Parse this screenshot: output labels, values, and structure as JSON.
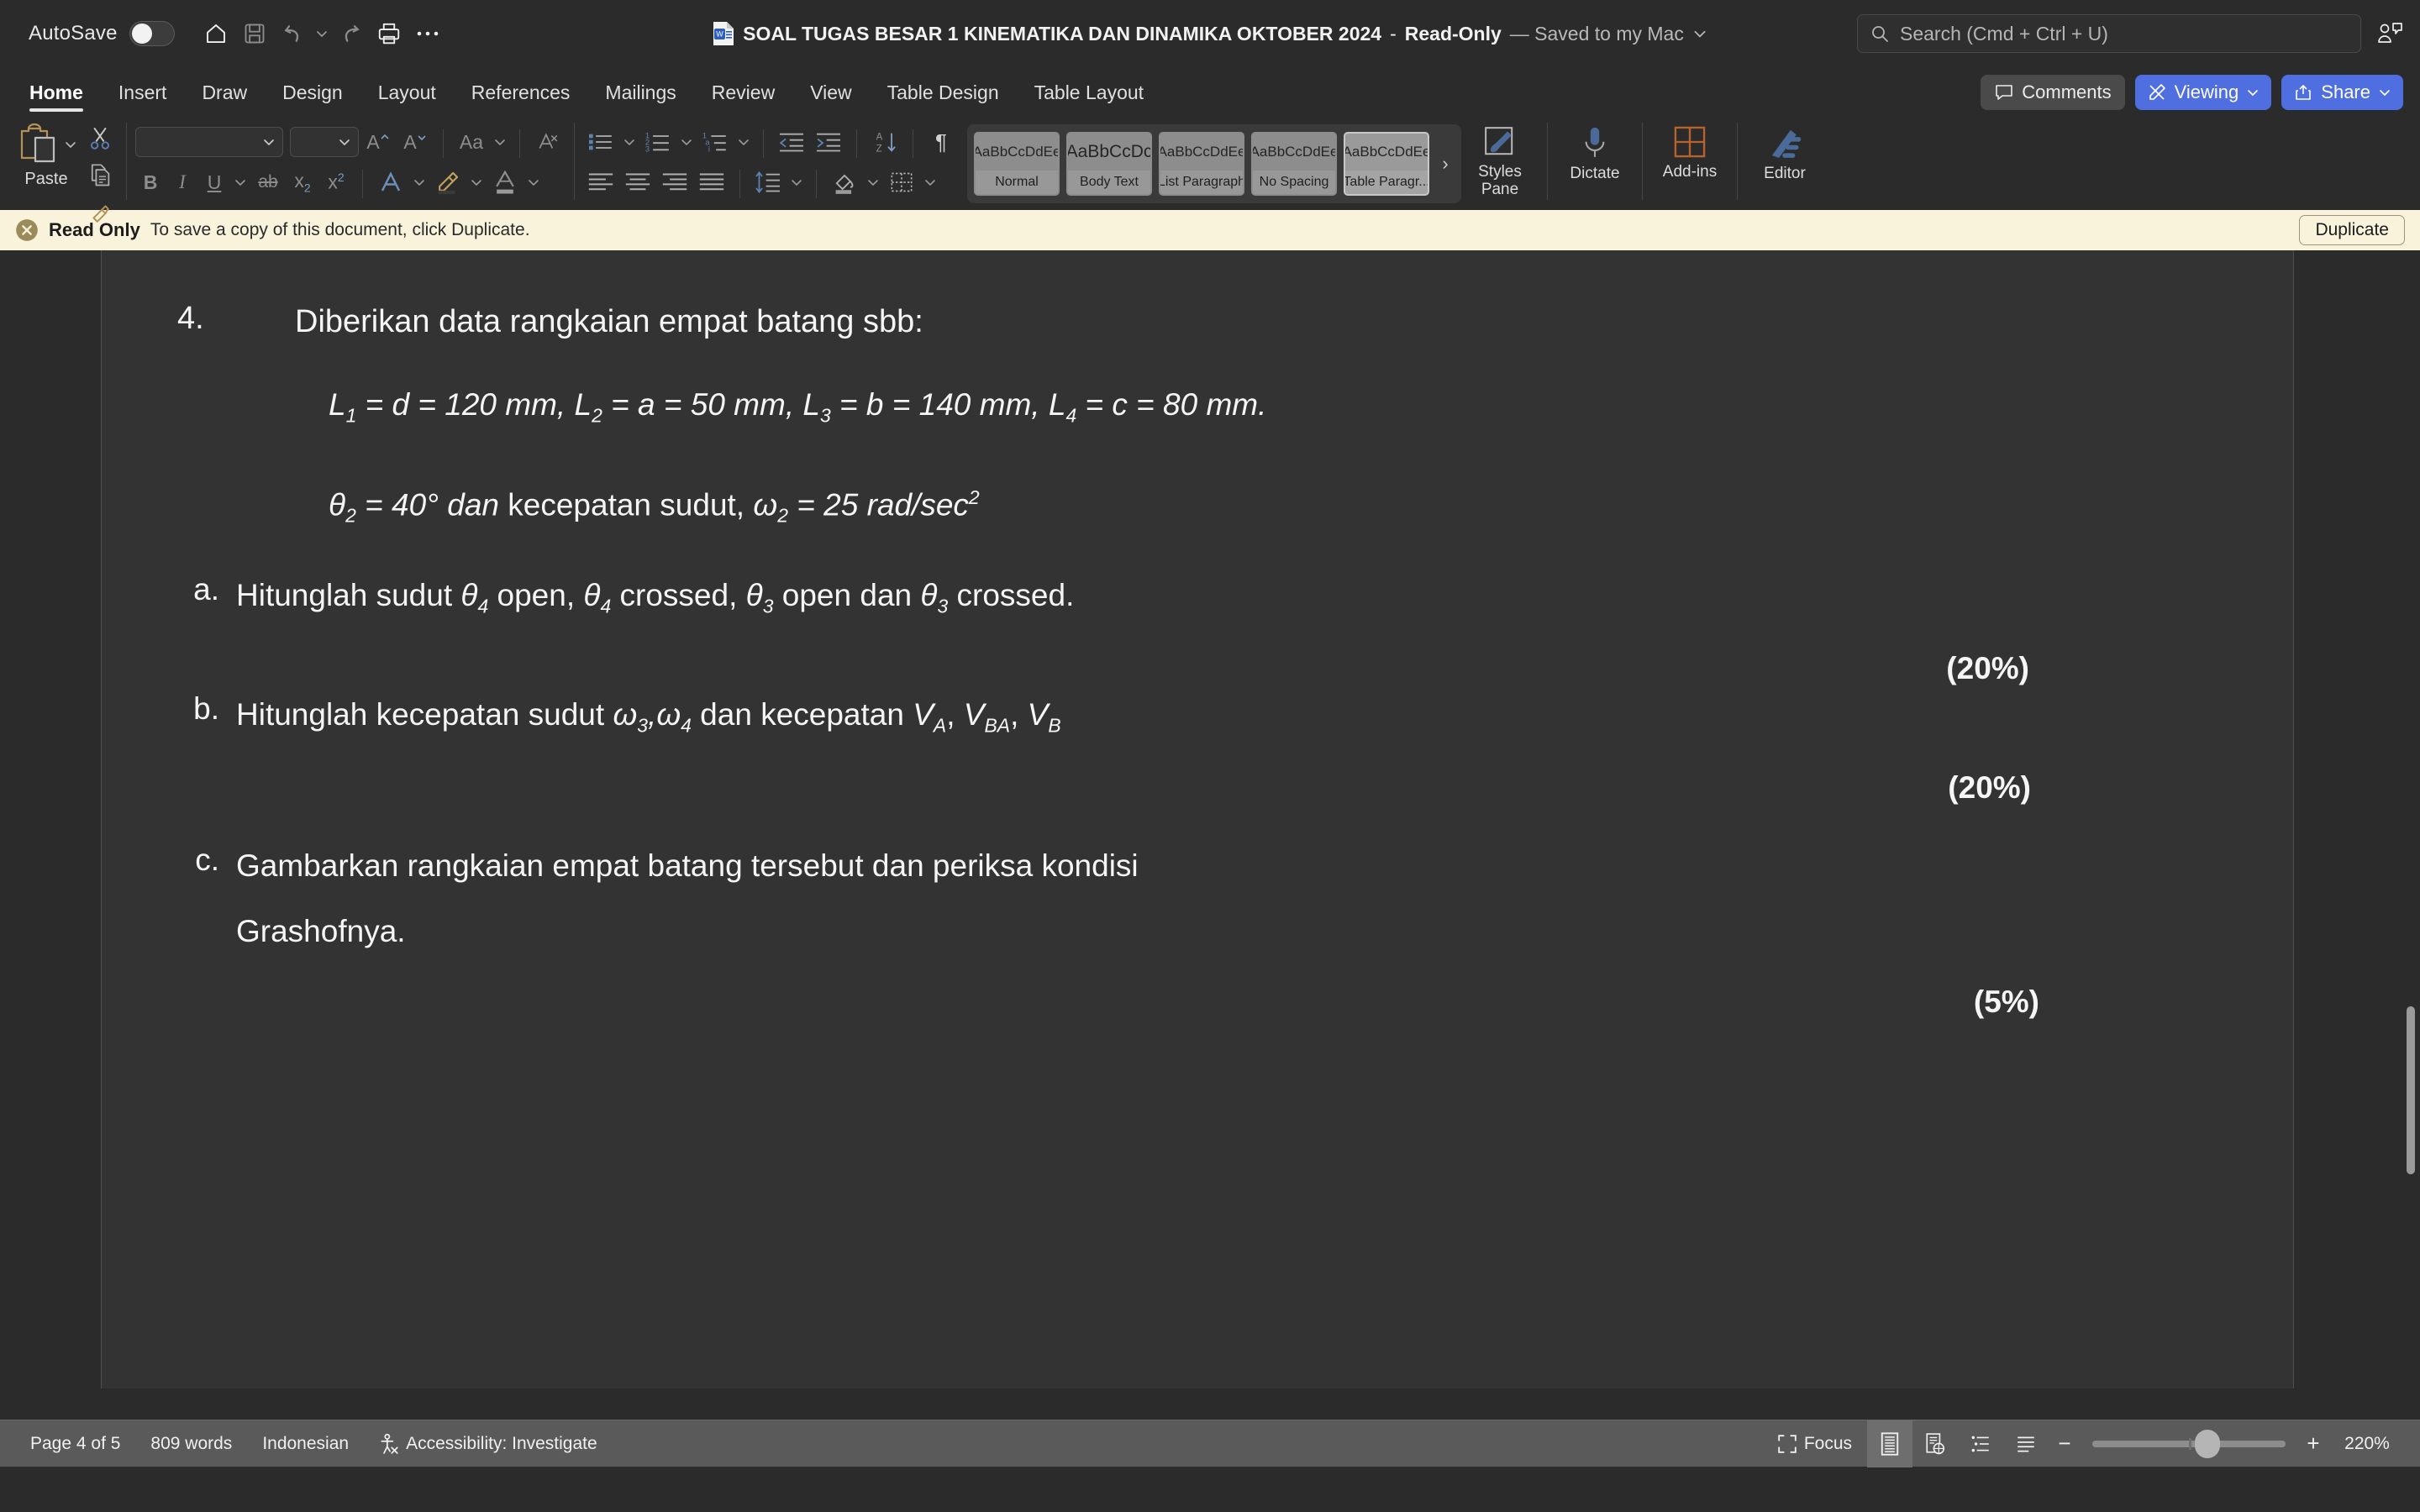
{
  "titlebar": {
    "autosave_label": "AutoSave",
    "autosave_state": "off",
    "quick_access": [
      "home-icon",
      "save-icon",
      "undo-icon",
      "undo-chevron-icon",
      "redo-icon",
      "print-icon",
      "more-icon"
    ],
    "doc_name": "SOAL TUGAS BESAR 1 KINEMATIKA DAN DINAMIKA OKTOBER 2024",
    "separator": "-",
    "read_only": "Read-Only",
    "saved_status": "— Saved to my Mac",
    "search_placeholder": "Search (Cmd + Ctrl + U)",
    "account_icon": "person-comment-icon"
  },
  "ribbon_tabs": {
    "items": [
      {
        "label": "Home",
        "active": true
      },
      {
        "label": "Insert",
        "active": false
      },
      {
        "label": "Draw",
        "active": false
      },
      {
        "label": "Design",
        "active": false
      },
      {
        "label": "Layout",
        "active": false
      },
      {
        "label": "References",
        "active": false
      },
      {
        "label": "Mailings",
        "active": false
      },
      {
        "label": "Review",
        "active": false
      },
      {
        "label": "View",
        "active": false
      },
      {
        "label": "Table Design",
        "active": false
      },
      {
        "label": "Table Layout",
        "active": false
      }
    ],
    "comments_label": "Comments",
    "viewing_label": "Viewing",
    "share_label": "Share"
  },
  "ribbon": {
    "paste_label": "Paste",
    "font_name_value": "",
    "font_size_value": "",
    "grow_font": "A",
    "shrink_font": "A",
    "change_case": "Aa",
    "clear_format": "A",
    "bold": "B",
    "italic": "I",
    "underline": "U",
    "strikethrough": "ab",
    "subscript": "x₂",
    "superscript": "x²",
    "text_effects": "A",
    "highlight": "highlight-icon",
    "font_color": "A",
    "styles": [
      {
        "preview": "AaBbCcDdEe",
        "name": "Normal",
        "selected": false,
        "big": false
      },
      {
        "preview": "AaBbCcDc",
        "name": "Body Text",
        "selected": false,
        "big": true
      },
      {
        "preview": "AaBbCcDdEe",
        "name": "List Paragraph",
        "selected": false,
        "big": false
      },
      {
        "preview": "AaBbCcDdEe",
        "name": "No Spacing",
        "selected": false,
        "big": false
      },
      {
        "preview": "AaBbCcDdEe",
        "name": "Table Paragr...",
        "selected": true,
        "big": false
      }
    ],
    "gallery_more": "›",
    "styles_pane_label": "Styles Pane",
    "dictate_label": "Dictate",
    "addins_label": "Add-ins",
    "editor_label": "Editor"
  },
  "banner": {
    "title": "Read Only",
    "message": "To save a copy of this document, click Duplicate.",
    "duplicate_label": "Duplicate"
  },
  "document": {
    "q_number": "4.",
    "q_text": "Diberikan data rangkaian empat batang sbb:",
    "formula_line": {
      "l1": "L",
      "l1sub": "1",
      "l1val": " = d = 120 mm, ",
      "l2": "L",
      "l2sub": "2",
      "l2val": " = a = 50 mm, ",
      "l3": "L",
      "l3sub": "3",
      "l3val": " = b = 140 mm, ",
      "l4": "L",
      "l4sub": "4",
      "l4val": " = c = 80 mm."
    },
    "theta_line": {
      "theta": "θ",
      "theta_sub": "2",
      "theta_val": " = 40° ",
      "dan": "dan",
      "kec": " kecepatan sudut, ",
      "omega": "ω",
      "omega_sub": "2",
      "omega_val": " = 25 rad/sec",
      "omega_sup": "2"
    },
    "items": [
      {
        "mark": "a.",
        "text_parts": [
          "Hitunglah sudut ",
          "θ",
          "4",
          " open, ",
          "θ",
          "4",
          " crossed, ",
          "θ",
          "3",
          " open dan ",
          "θ",
          "3",
          " crossed."
        ],
        "percent": "(20%)"
      },
      {
        "mark": "b.",
        "percent": "(20%)"
      },
      {
        "mark": "c.",
        "text": "Gambarkan rangkaian empat batang tersebut dan periksa kondisi Grashofnya.",
        "percent": "(5%)"
      }
    ],
    "item_b": {
      "pre": "Hitunglah kecepatan sudut ",
      "w3": "ω",
      "w3sub": "3",
      "comma": ",",
      "w4": "ω",
      "w4sub": "4",
      "mid": " dan kecepatan ",
      "vA": "V",
      "vAsub": "A",
      "c1": ", ",
      "vBA": "V",
      "vBAsub": "BA",
      "c2": ", ",
      "vB": "V",
      "vBsub": "B"
    },
    "item_c_line1": "Gambarkan rangkaian empat batang tersebut dan periksa kondisi",
    "item_c_line2": "Grashofnya."
  },
  "statusbar": {
    "page": "Page 4 of 5",
    "words": "809 words",
    "language": "Indonesian",
    "accessibility": "Accessibility: Investigate",
    "focus_label": "Focus",
    "views": [
      "print-layout-icon",
      "web-layout-icon",
      "outline-icon",
      "draft-icon"
    ],
    "active_view": 0,
    "zoom_minus": "−",
    "zoom_plus": "+",
    "zoom_level": "220%"
  },
  "colors": {
    "accent_blue": "#4f6fe0",
    "banner_bg": "#faf3dc",
    "ribbon_bg": "#2b2b2b",
    "page_bg": "#333333",
    "status_bg": "#5a5a5a"
  }
}
